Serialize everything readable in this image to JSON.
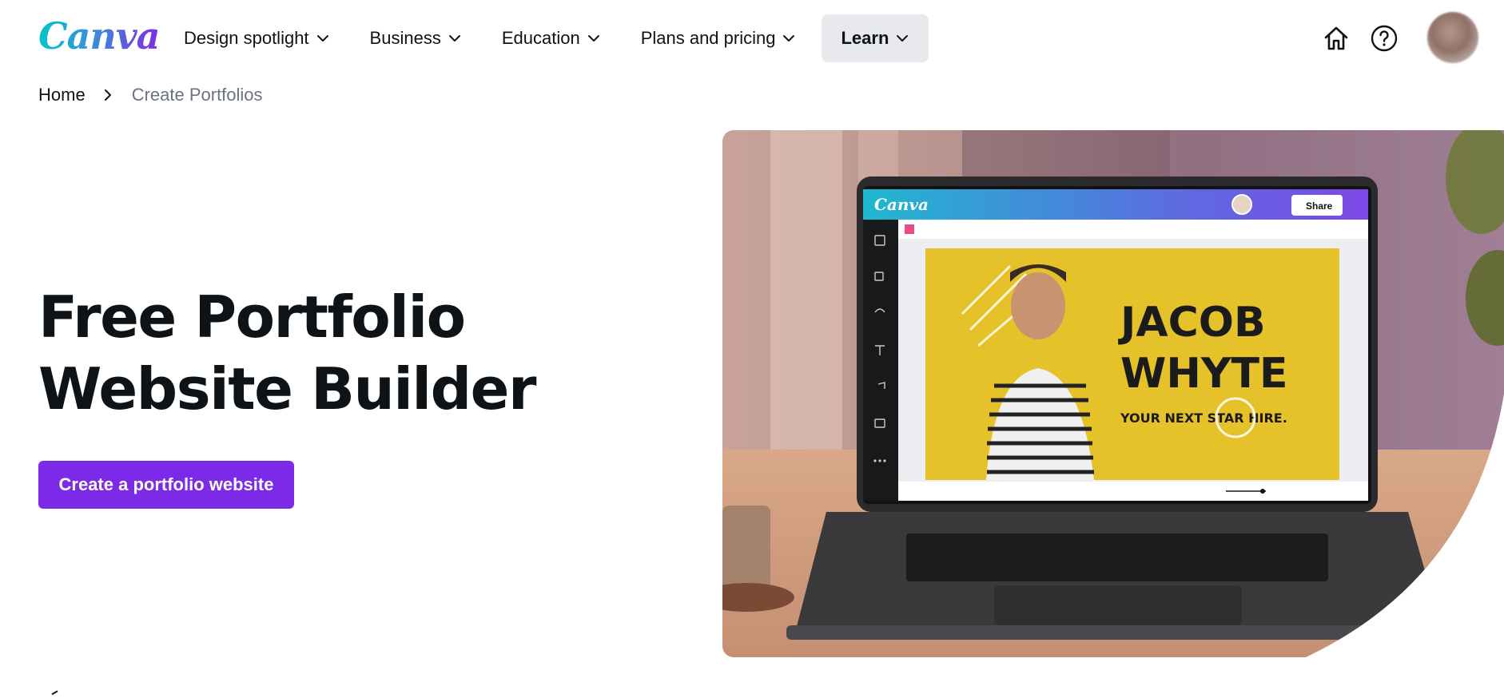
{
  "header": {
    "logo": "Canva",
    "nav": [
      {
        "label": "Design spotlight"
      },
      {
        "label": "Business"
      },
      {
        "label": "Education"
      },
      {
        "label": "Plans and pricing"
      },
      {
        "label": "Learn"
      }
    ],
    "icons": [
      "home-icon",
      "help-icon"
    ]
  },
  "breadcrumb": {
    "home": "Home",
    "current": "Create Portfolios"
  },
  "hero": {
    "title_line1": "Free Portfolio",
    "title_line2": "Website Builder",
    "cta_label": "Create a portfolio website"
  },
  "mockup": {
    "app_logo": "Canva",
    "share_label": "Share",
    "design_name_line1": "JACOB",
    "design_name_line2": "WHYTE",
    "design_tagline": "YOUR NEXT STAR HIRE."
  },
  "colors": {
    "brand_purple": "#7d2ae8",
    "brand_teal": "#00c4cc",
    "active_nav_bg": "#e8e9ec",
    "design_yellow": "#e6c22a"
  }
}
